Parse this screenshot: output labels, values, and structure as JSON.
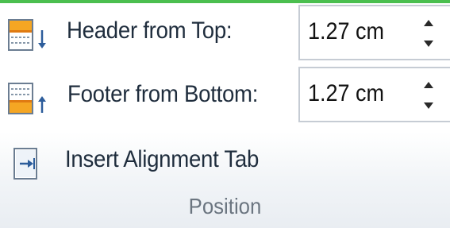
{
  "group": {
    "title": "Position",
    "accent_color": "#4bbf4f"
  },
  "header_from_top": {
    "label": "Header from Top:",
    "value": "1.27 cm",
    "icon": "header-position-icon"
  },
  "footer_from_bottom": {
    "label": "Footer from Bottom:",
    "value": "1.27 cm",
    "icon": "footer-position-icon"
  },
  "insert_alignment_tab": {
    "label": "Insert Alignment Tab",
    "icon": "insert-alignment-tab-icon"
  }
}
